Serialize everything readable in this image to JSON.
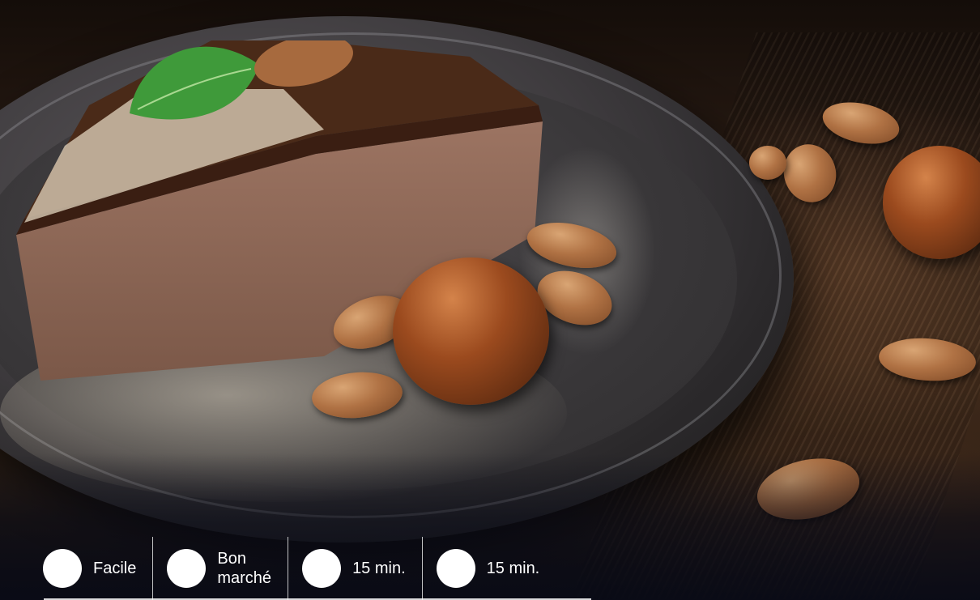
{
  "info": [
    {
      "icon": "difficulty-icon",
      "label": "Facile"
    },
    {
      "icon": "cost-icon",
      "label": "Bon\nmarché"
    },
    {
      "icon": "prep-time-icon",
      "label": "15 min."
    },
    {
      "icon": "cook-time-icon",
      "label": "15 min."
    }
  ]
}
